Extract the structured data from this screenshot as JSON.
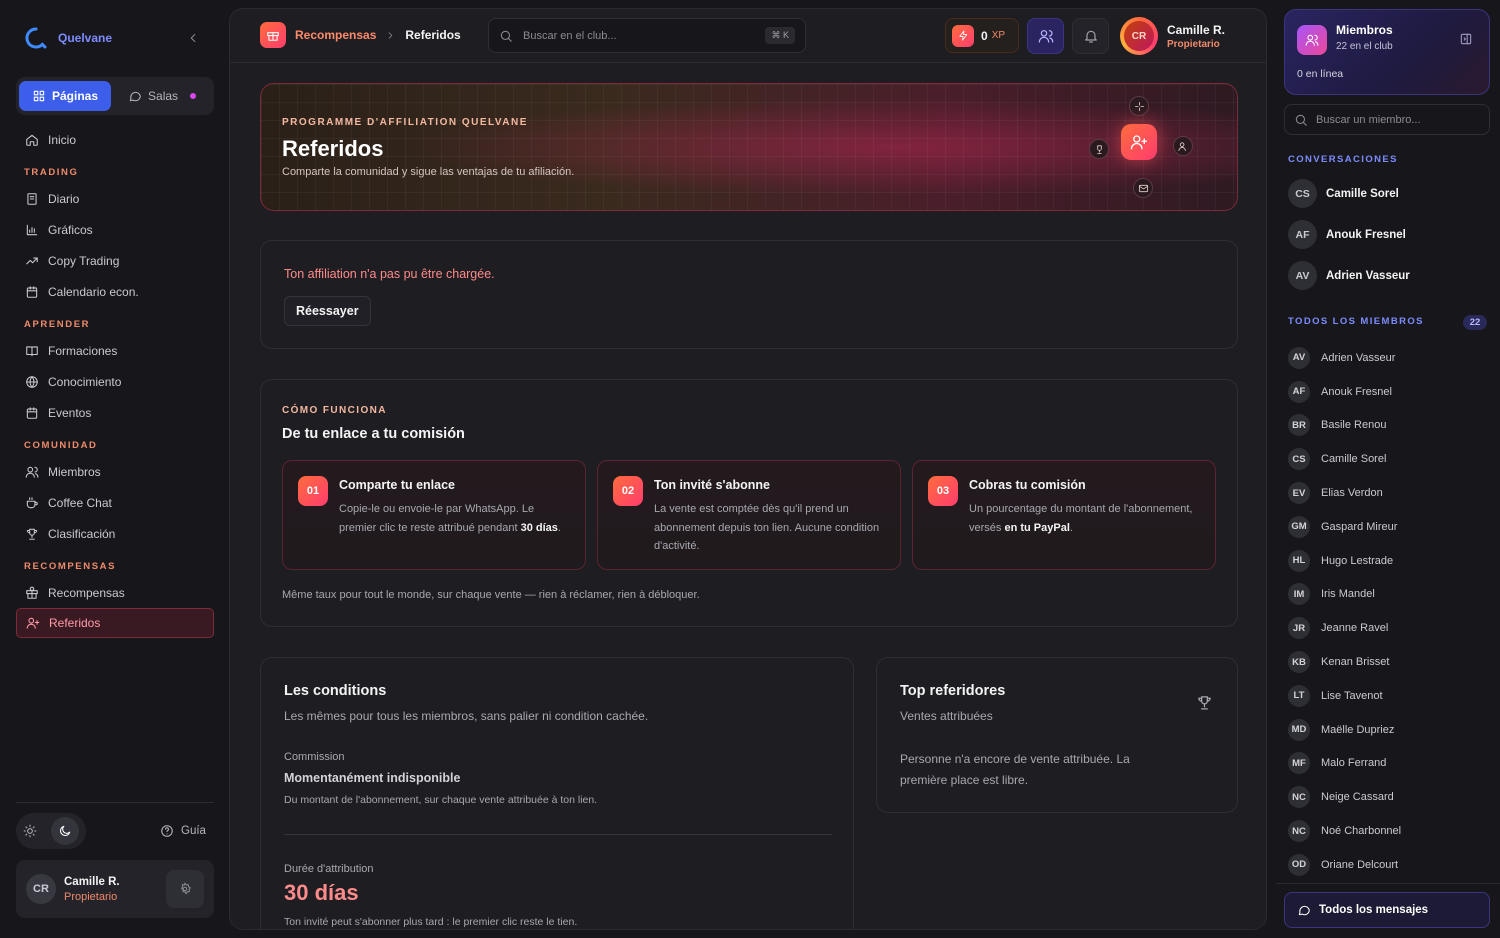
{
  "app": {
    "name": "Quelvane"
  },
  "left_sidebar": {
    "segment": {
      "pages_label": "Páginas",
      "rooms_label": "Salas"
    },
    "home_label": "Inicio",
    "sections": [
      {
        "title": "TRADING",
        "items": [
          {
            "label": "Diario",
            "icon": "journal-icon"
          },
          {
            "label": "Gráficos",
            "icon": "chart-icon"
          },
          {
            "label": "Copy Trading",
            "icon": "trend-icon"
          },
          {
            "label": "Calendario econ.",
            "icon": "calendar-icon"
          }
        ]
      },
      {
        "title": "APRENDER",
        "items": [
          {
            "label": "Formaciones",
            "icon": "book-icon"
          },
          {
            "label": "Conocimiento",
            "icon": "globe-icon"
          },
          {
            "label": "Eventos",
            "icon": "calendar-icon"
          }
        ]
      },
      {
        "title": "COMUNIDAD",
        "items": [
          {
            "label": "Miembros",
            "icon": "users-icon"
          },
          {
            "label": "Coffee Chat",
            "icon": "coffee-icon"
          },
          {
            "label": "Clasificación",
            "icon": "trophy-icon"
          }
        ]
      },
      {
        "title": "RECOMPENSAS",
        "items": [
          {
            "label": "Recompensas",
            "icon": "gift-icon"
          },
          {
            "label": "Referidos",
            "icon": "user-plus-icon",
            "active": true
          }
        ]
      }
    ],
    "guide_label": "Guía",
    "user": {
      "initials": "CR",
      "name": "Camille R.",
      "role": "Propietario"
    }
  },
  "topbar": {
    "breadcrumb": {
      "parent": "Recompensas",
      "current": "Referidos"
    },
    "search_placeholder": "Buscar en el club...",
    "shortcut": "⌘ K",
    "xp_value": "0",
    "xp_unit": "XP",
    "user": {
      "initials": "CR",
      "name": "Camille R.",
      "role": "Propietario"
    }
  },
  "hero": {
    "eyebrow": "PROGRAMME D'AFFILIATION QUELVANE",
    "title": "Referidos",
    "subtitle": "Comparte la comunidad y sigue las ventajas de tu afiliación."
  },
  "error": {
    "message": "Ton affiliation n'a pas pu être chargée.",
    "retry_label": "Réessayer"
  },
  "how": {
    "eyebrow": "CÓMO FUNCIONA",
    "title": "De tu enlace a tu comisión",
    "steps": [
      {
        "num": "01",
        "title": "Comparte tu enlace",
        "body_pre": "Copie-le ou envoie-le par WhatsApp. Le premier clic te reste attribué pendant ",
        "body_bold": "30 días",
        "body_post": "."
      },
      {
        "num": "02",
        "title": "Ton invité s'abonne",
        "body_pre": "La vente est comptée dès qu'il prend un abonnement depuis ton lien. Aucune condition d'activité.",
        "body_bold": "",
        "body_post": ""
      },
      {
        "num": "03",
        "title": "Cobras tu comisión",
        "body_pre": "Un pourcentage du montant de l'abonnement, versés ",
        "body_bold": "en tu PayPal",
        "body_post": "."
      }
    ],
    "footer": "Même taux pour tout le monde, sur chaque vente — rien à réclamer, rien à débloquer."
  },
  "conditions": {
    "title": "Les conditions",
    "subtitle": "Les mêmes pour tous les miembros, sans palier ni condition cachée.",
    "commission_label": "Commission",
    "commission_value": "Momentanément indisponible",
    "commission_desc": "Du montant de l'abonnement, sur chaque vente attribuée à ton lien.",
    "duration_label": "Durée d'attribution",
    "duration_value": "30 días",
    "duration_desc": "Ton invité peut s'abonner plus tard : le premier clic reste le tien."
  },
  "top_referrers": {
    "title": "Top referidores",
    "subtitle": "Ventes attribuées",
    "empty": "Personne n'a encore de vente attribuée. La première place est libre."
  },
  "right_sidebar": {
    "title": "Miembros",
    "count_text": "22 en el club",
    "online_text": "0 en línea",
    "search_placeholder": "Buscar un miembro...",
    "conversations_title": "CONVERSACIONES",
    "conversations": [
      {
        "initials": "CS",
        "name": "Camille Sorel"
      },
      {
        "initials": "AF",
        "name": "Anouk Fresnel"
      },
      {
        "initials": "AV",
        "name": "Adrien Vasseur"
      }
    ],
    "all_members_title": "TODOS LOS MIEMBROS",
    "all_members_count": "22",
    "members": [
      {
        "initials": "AV",
        "name": "Adrien Vasseur"
      },
      {
        "initials": "AF",
        "name": "Anouk Fresnel"
      },
      {
        "initials": "BR",
        "name": "Basile Renou"
      },
      {
        "initials": "CS",
        "name": "Camille Sorel"
      },
      {
        "initials": "EV",
        "name": "Elias Verdon"
      },
      {
        "initials": "GM",
        "name": "Gaspard Mireur"
      },
      {
        "initials": "HL",
        "name": "Hugo Lestrade"
      },
      {
        "initials": "IM",
        "name": "Iris Mandel"
      },
      {
        "initials": "JR",
        "name": "Jeanne Ravel"
      },
      {
        "initials": "KB",
        "name": "Kenan Brisset"
      },
      {
        "initials": "LT",
        "name": "Lise Tavenot"
      },
      {
        "initials": "MD",
        "name": "Maëlle Dupriez"
      },
      {
        "initials": "MF",
        "name": "Malo Ferrand"
      },
      {
        "initials": "NC",
        "name": "Neige Cassard"
      },
      {
        "initials": "NC",
        "name": "Noé Charbonnel"
      },
      {
        "initials": "OD",
        "name": "Oriane Delcourt"
      }
    ],
    "all_messages_label": "Todos los mensajes"
  },
  "colors": {
    "accent": "#ff5a4d",
    "brand": "#7c8cff",
    "pink": "#ff3d6e"
  }
}
